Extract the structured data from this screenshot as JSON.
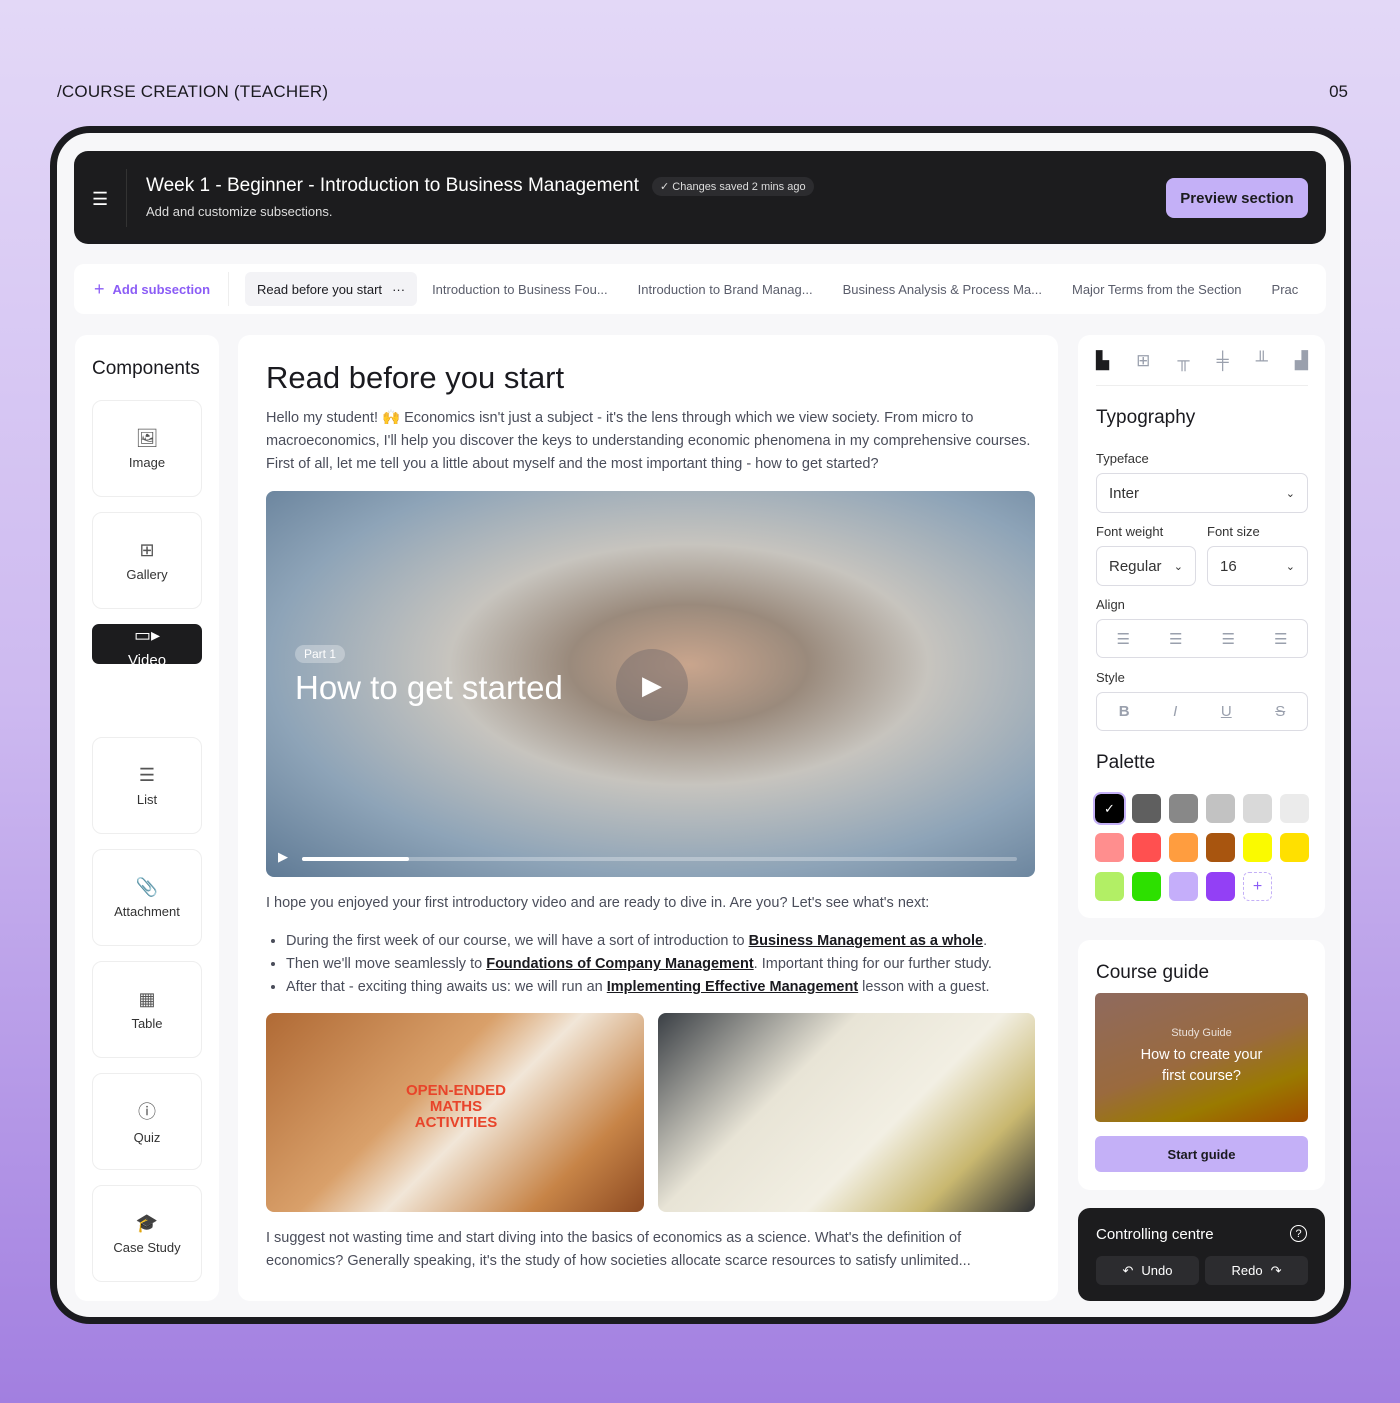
{
  "page": {
    "crumb": "/COURSE CREATION (TEACHER)",
    "number": "05"
  },
  "header": {
    "title": "Week 1 - Beginner - Introduction to Business Management",
    "saved": "✓ Changes saved 2 mins ago",
    "subtitle": "Add and customize subsections.",
    "preview": "Preview section"
  },
  "tabs": {
    "add": "Add subsection",
    "items": [
      "Read before you start",
      "Introduction to Business Fou...",
      "Introduction to Brand Manag...",
      "Business Analysis & Process Ma...",
      "Major Terms from the Section",
      "Prac"
    ]
  },
  "components": {
    "title": "Components",
    "items": [
      {
        "label": "Image",
        "icon": "image-icon"
      },
      {
        "label": "Gallery",
        "icon": "gallery-icon"
      },
      {
        "label": "Video",
        "icon": "video-icon"
      },
      {
        "label": "List",
        "icon": "list-icon"
      },
      {
        "label": "Attachment",
        "icon": "paperclip-icon"
      },
      {
        "label": "Table",
        "icon": "table-icon"
      },
      {
        "label": "Quiz",
        "icon": "question-icon"
      },
      {
        "label": "Case Study",
        "icon": "graduation-cap-icon"
      }
    ],
    "selected": "Video"
  },
  "main": {
    "title": "Read before you start",
    "intro": "Hello my student! 🙌 Economics isn't just a subject - it's the lens through which we view society. From micro to macroeconomics, I'll help you discover the keys to understanding economic phenomena in my comprehensive courses. First of all, let me tell you a little about myself and the most important thing - how to get started?",
    "video": {
      "part": "Part 1",
      "title": "How to get started",
      "progress": 0.15
    },
    "after_video": "I hope you enjoyed your first introductory video and are ready to dive in. Are you? Let's see what's next:",
    "bullets": [
      {
        "pre": "During the first week of our course, we will have a sort of introduction to ",
        "link": "Business Management as a whole",
        "post": "."
      },
      {
        "pre": "Then we'll move seamlessly to ",
        "link": "Foundations of Company Management",
        "post": ". Important thing for our further study."
      },
      {
        "pre": "After that - exciting thing awaits us: we will run an ",
        "link": "Implementing Effective Management",
        "post": " lesson with a guest."
      }
    ],
    "image1_text": "OPEN-ENDED MATHS ACTIVITIES",
    "outro": "I suggest not wasting time and start diving into the basics of economics as a science. What's the definition of economics? Generally speaking, it's the study of how societies allocate scarce resources to satisfy unlimited..."
  },
  "typography": {
    "title": "Typography",
    "typeface_label": "Typeface",
    "typeface": "Inter",
    "weight_label": "Font weight",
    "weight": "Regular",
    "size_label": "Font size",
    "size": "16",
    "align_label": "Align",
    "style_label": "Style",
    "style_buttons": [
      "B",
      "I",
      "U",
      "S"
    ]
  },
  "palette": {
    "title": "Palette",
    "colors": [
      "#000000",
      "#5f5f5f",
      "#888888",
      "#c2c2c2",
      "#d9d9d9",
      "#ebebeb",
      "#ff8e8e",
      "#ff5050",
      "#ff9d3f",
      "#a8550f",
      "#fafa00",
      "#ffe000",
      "#b2ef65",
      "#2de000",
      "#c5aefa",
      "#9340f5"
    ],
    "selected": "#000000"
  },
  "guide": {
    "title": "Course guide",
    "kicker": "Study Guide",
    "heading": "How to create your first course?",
    "button": "Start guide"
  },
  "control": {
    "title": "Controlling centre",
    "undo": "Undo",
    "redo": "Redo"
  }
}
